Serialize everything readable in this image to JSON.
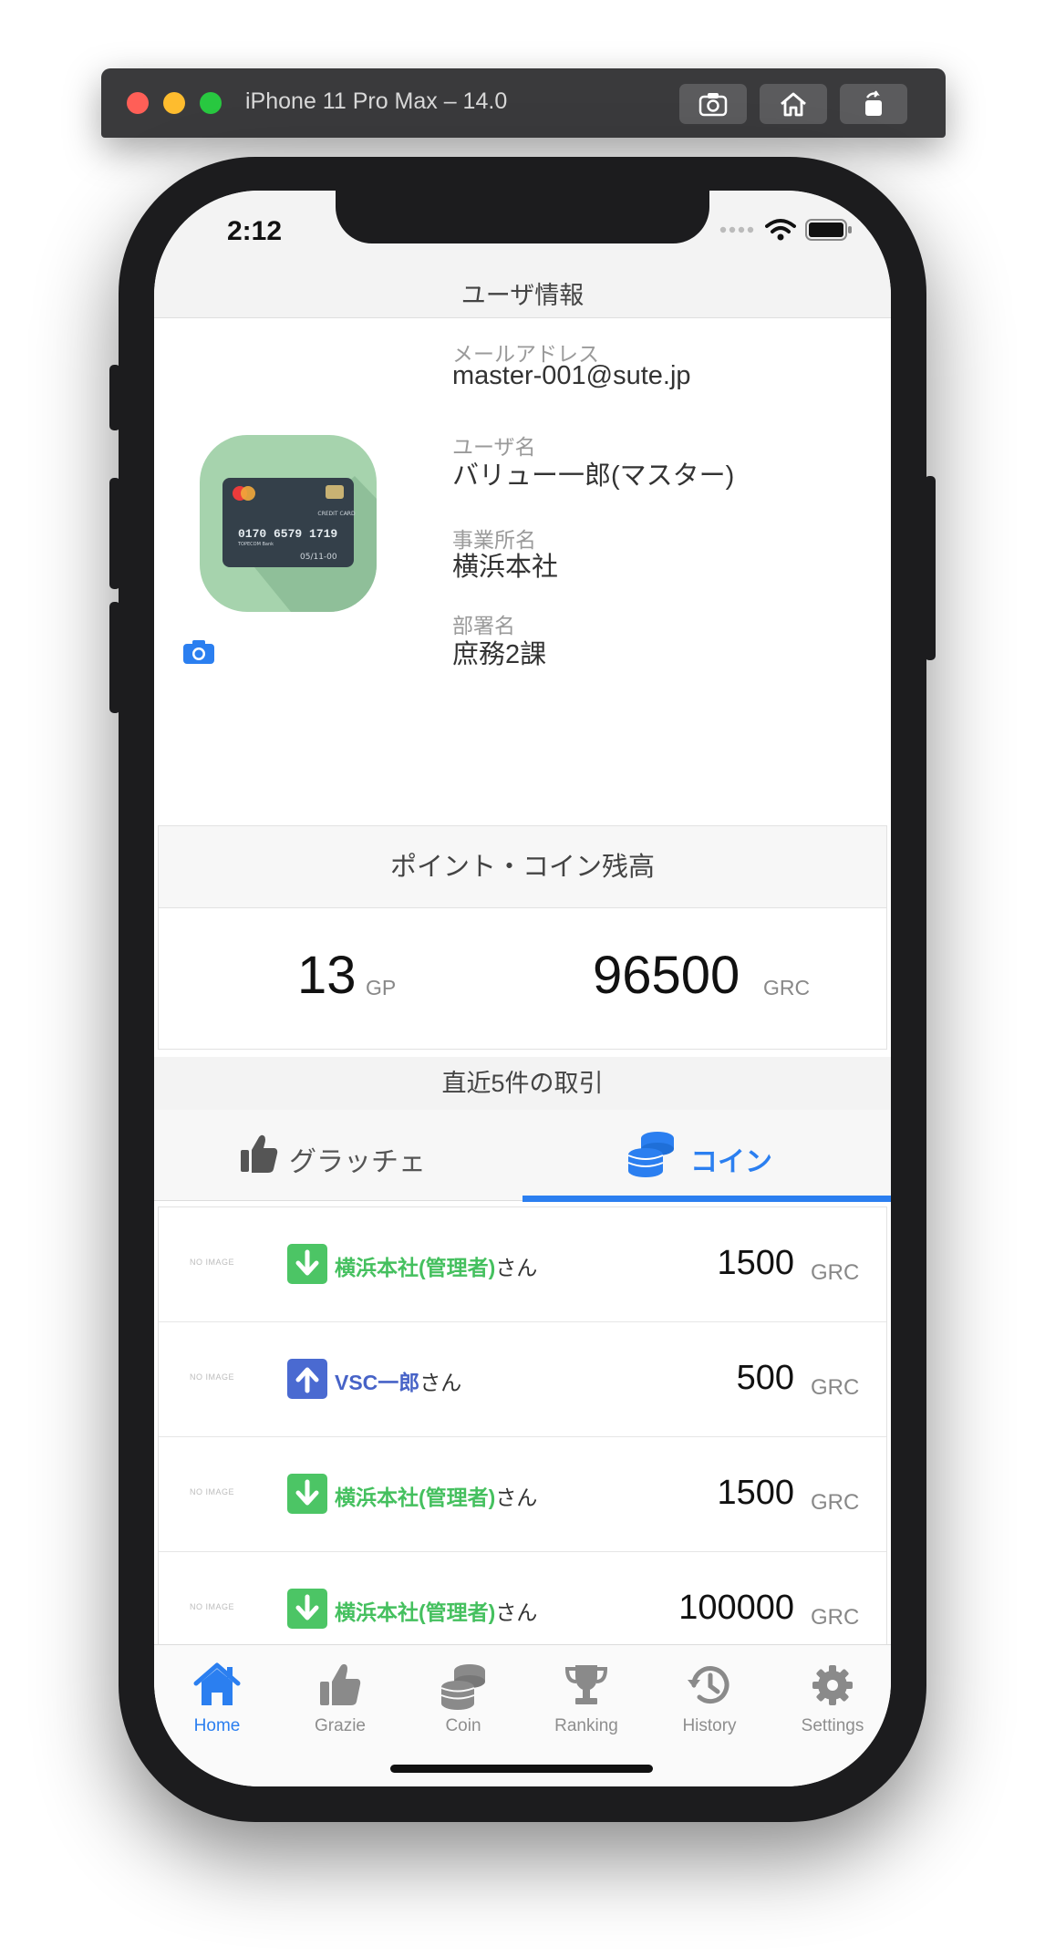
{
  "simulator": {
    "title": "iPhone 11 Pro Max – 14.0"
  },
  "status": {
    "time": "2:12"
  },
  "user_info": {
    "header": "ユーザ情報",
    "email_label": "メールアドレス",
    "email": "master-001@sute.jp",
    "name_label": "ユーザ名",
    "name": "バリュー一郎(マスター)",
    "office_label": "事業所名",
    "office": "横浜本社",
    "dept_label": "部署名",
    "dept": "庶務2課",
    "card": {
      "brand": "CREDIT CARD",
      "number": "0170  6579  1719",
      "bank": "TOPECOM Bank",
      "expiry": "05/11-00"
    }
  },
  "balance": {
    "header": "ポイント・コイン残高",
    "points": "13",
    "points_unit": "GP",
    "coins": "96500",
    "coins_unit": "GRC"
  },
  "recent": {
    "header": "直近5件の取引",
    "tabs": [
      {
        "label": "グラッチェ",
        "icon": "thumbs-up-icon",
        "active": false
      },
      {
        "label": "コイン",
        "icon": "coins-icon",
        "active": true
      }
    ],
    "transactions": [
      {
        "noimage": "NO IMAGE",
        "direction": "in",
        "name": "横浜本社(管理者)",
        "suffix": "さん",
        "amount": "1500",
        "unit": "GRC"
      },
      {
        "noimage": "NO IMAGE",
        "direction": "out",
        "name": "VSC一郎",
        "suffix": "さん",
        "amount": "500",
        "unit": "GRC"
      },
      {
        "noimage": "NO IMAGE",
        "direction": "in",
        "name": "横浜本社(管理者)",
        "suffix": "さん",
        "amount": "1500",
        "unit": "GRC"
      },
      {
        "noimage": "NO IMAGE",
        "direction": "in",
        "name": "横浜本社(管理者)",
        "suffix": "さん",
        "amount": "100000",
        "unit": "GRC"
      }
    ]
  },
  "tab_bar": [
    {
      "label": "Home",
      "icon": "home-icon",
      "active": true
    },
    {
      "label": "Grazie",
      "icon": "thumbs-up-icon",
      "active": false
    },
    {
      "label": "Coin",
      "icon": "coins-icon",
      "active": false
    },
    {
      "label": "Ranking",
      "icon": "trophy-icon",
      "active": false
    },
    {
      "label": "History",
      "icon": "history-icon",
      "active": false
    },
    {
      "label": "Settings",
      "icon": "gear-icon",
      "active": false
    }
  ],
  "colors": {
    "accent": "#2b7ff0",
    "incoming": "#4cc565",
    "outgoing": "#4a6ad1",
    "avatar_bg": "#a6d3ad"
  }
}
